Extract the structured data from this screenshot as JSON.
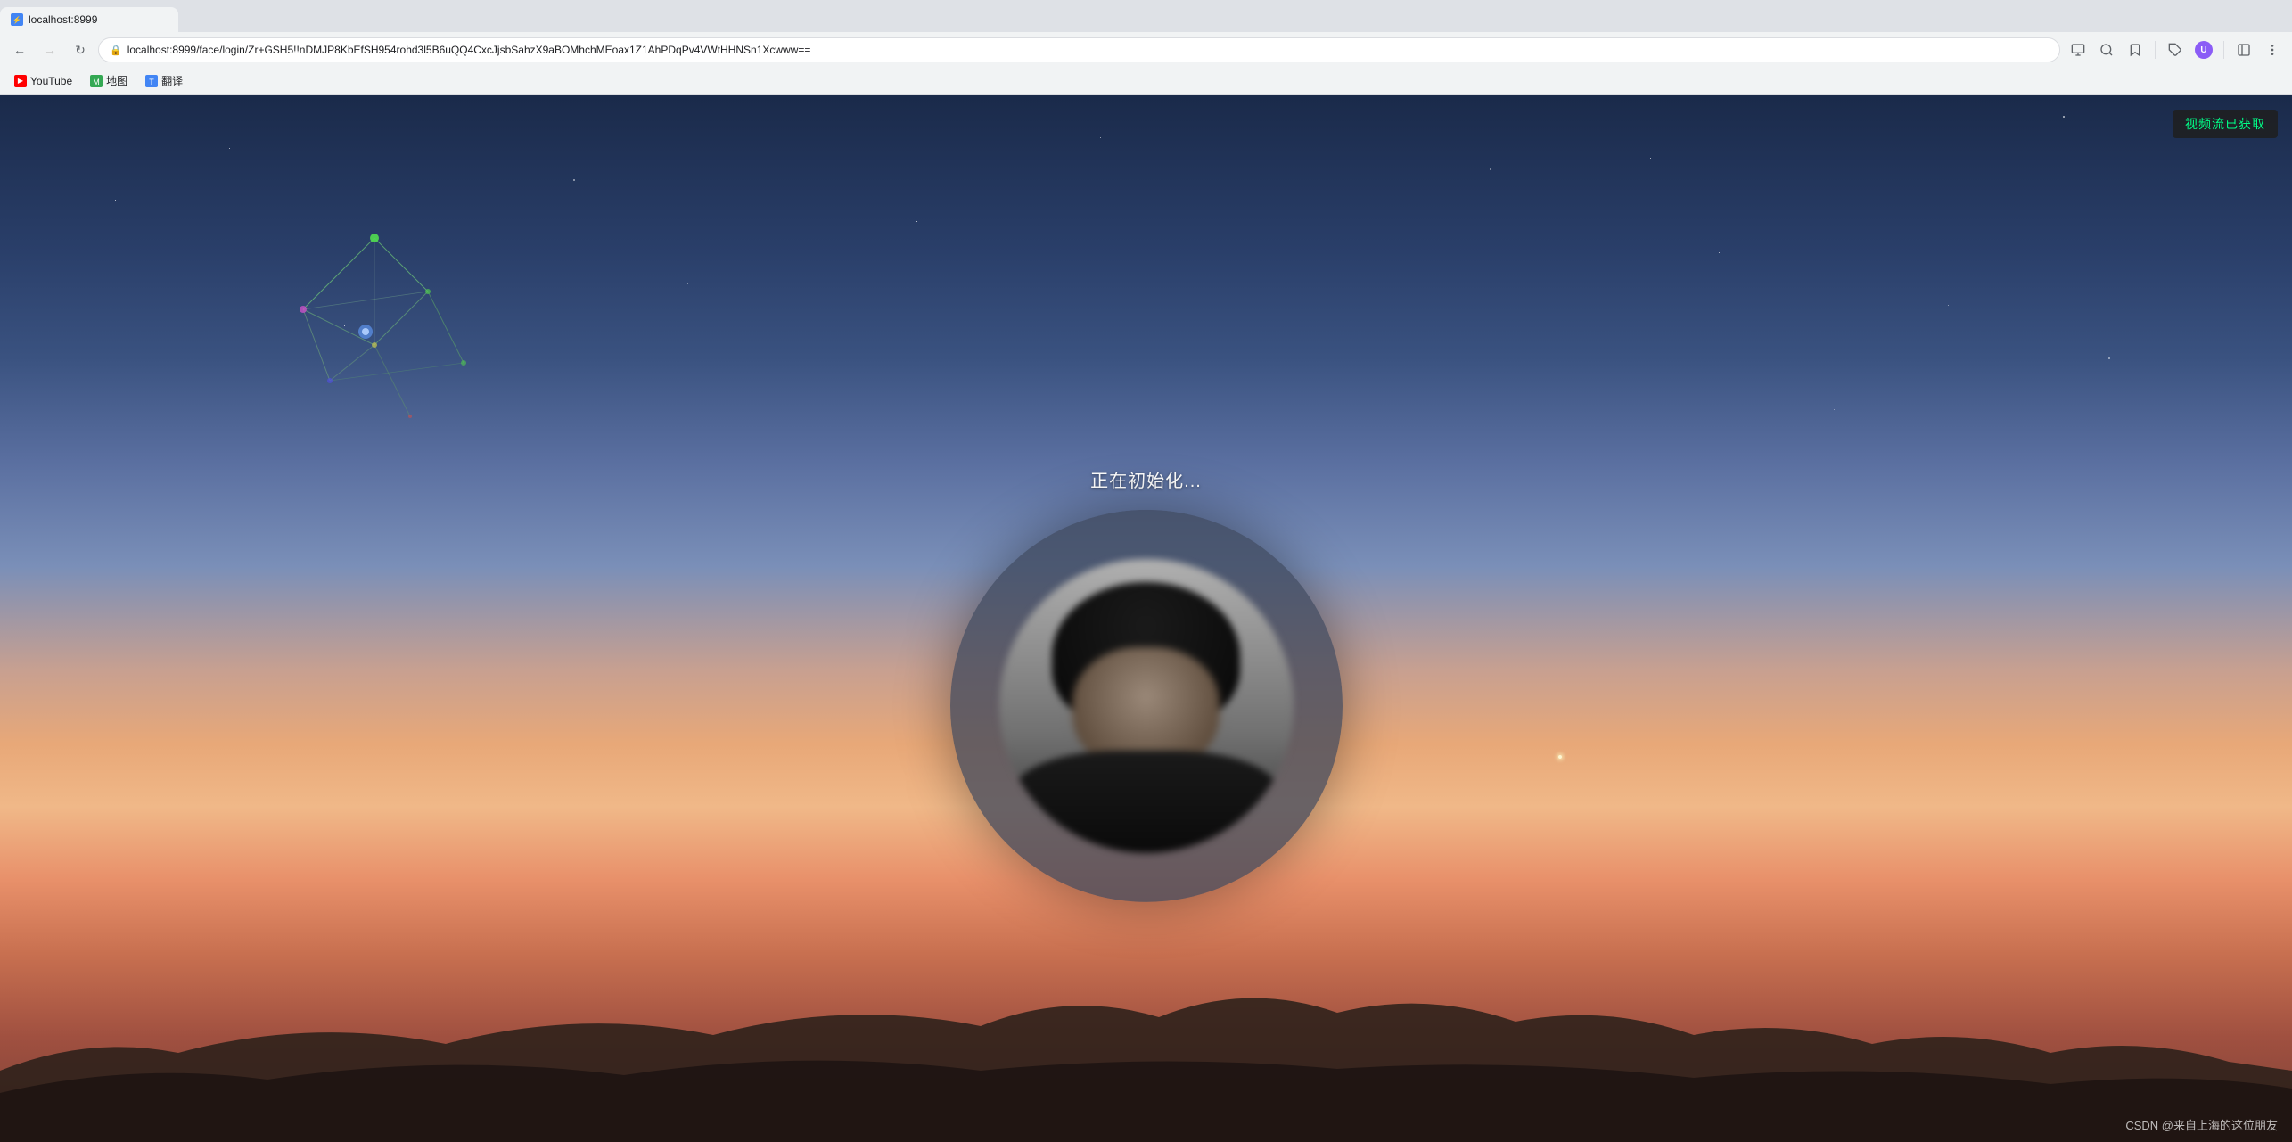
{
  "browser": {
    "url": "localhost:8999/face/login/Zr+GSH5!!nDMJP8KbEfSH954rohd3l5B6uQQ4CxcJjsbSahzX9aBOMhchMEoax1Z1AhPDqPv4VWtHHNSn1Xcwww==",
    "tab_title": "localhost:8999",
    "reload_title": "重新加载"
  },
  "bookmarks": [
    {
      "id": "youtube",
      "label": "YouTube",
      "icon": "▶"
    },
    {
      "id": "maps",
      "label": "地图",
      "icon": "📍"
    },
    {
      "id": "translate",
      "label": "翻译",
      "icon": "🌐"
    }
  ],
  "page": {
    "notification_badge": "视频流已获取",
    "status_text": "正在初始化...",
    "watermark": "CSDN @来自上海的这位朋友"
  }
}
